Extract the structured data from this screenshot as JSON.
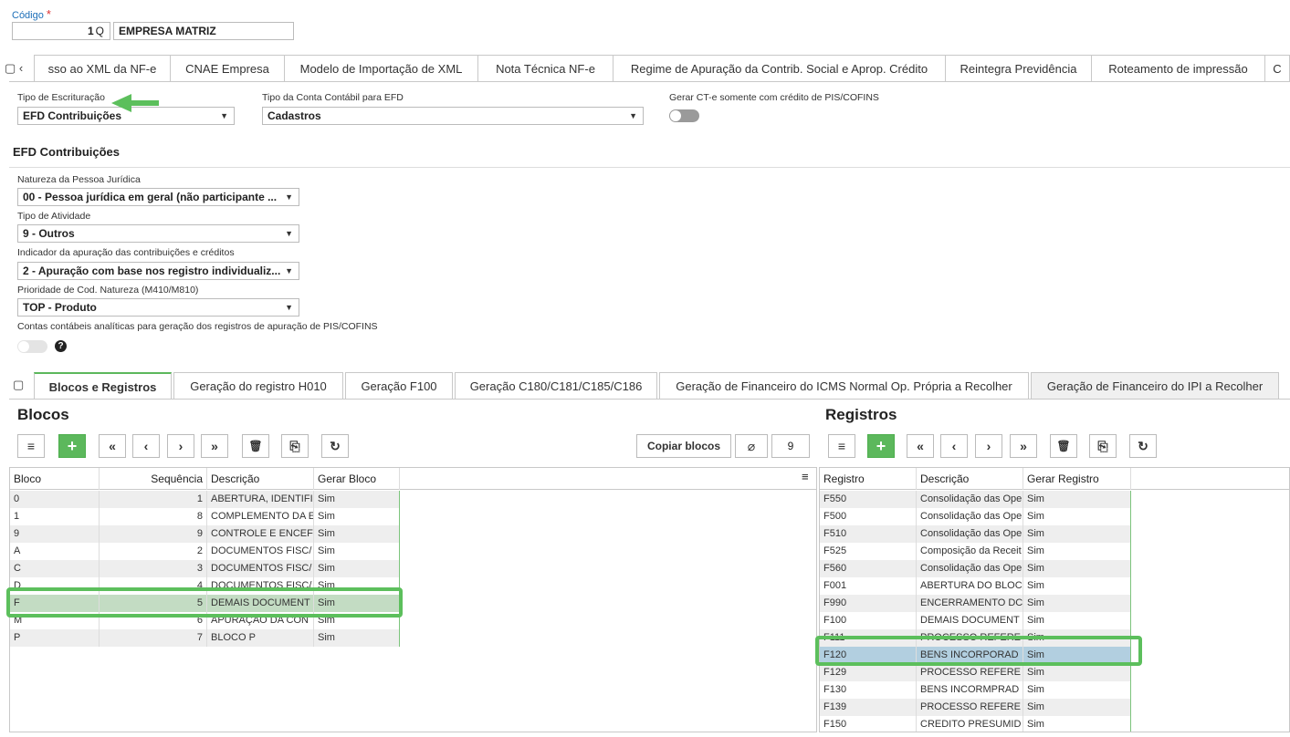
{
  "header": {
    "code_label": "Código",
    "required_mark": "*",
    "code_value": "1",
    "search_glyph": "Q",
    "company": "EMPRESA MATRIZ"
  },
  "top_tabs": [
    "sso ao XML da NF-e",
    "CNAE Empresa",
    "Modelo de Importação de XML",
    "Nota Técnica NF-e",
    "Regime de Apuração da Contrib. Social e Aprop. Crédito",
    "Reintegra Previdência",
    "Roteamento de impressão",
    "C"
  ],
  "form": {
    "tipo_escrituracao_label": "Tipo de Escrituração",
    "tipo_escrituracao_value": "EFD Contribuições",
    "tipo_conta_label": "Tipo da Conta Contábil para EFD",
    "tipo_conta_value": "Cadastros",
    "gerar_cte_label": "Gerar CT-e somente com crédito de PIS/COFINS",
    "section_title": "EFD Contribuições",
    "natureza_label": "Natureza da Pessoa Jurídica",
    "natureza_value": "00 - Pessoa jurídica em geral (não participante ...",
    "atividade_label": "Tipo de Atividade",
    "atividade_value": "9 - Outros",
    "indicador_label": "Indicador da apuração das contribuições e créditos",
    "indicador_value": "2 - Apuração com base nos registro individualiz...",
    "prioridade_label": "Prioridade de Cod. Natureza (M410/M810)",
    "prioridade_value": "TOP - Produto",
    "contas_label": "Contas contábeis analíticas para geração dos registros de apuração de PIS/COFINS",
    "help_glyph": "?",
    "caret": "▼"
  },
  "bottom_tabs": [
    "Blocos e Registros",
    "Geração do registro H010",
    "Geração F100",
    "Geração C180/C181/C185/C186",
    "Geração de Financeiro do ICMS Normal Op. Própria a Recolher",
    "Geração de Financeiro do IPI a Recolher"
  ],
  "blocos": {
    "title": "Blocos",
    "copy_button": "Copiar blocos",
    "count": "9",
    "columns": [
      "Bloco",
      "Sequência",
      "Descrição",
      "Gerar Bloco"
    ],
    "rows": [
      [
        "0",
        "1",
        "ABERTURA, IDENTIFI",
        "Sim"
      ],
      [
        "1",
        "8",
        "COMPLEMENTO DA E",
        "Sim"
      ],
      [
        "9",
        "9",
        "CONTROLE E ENCEF",
        "Sim"
      ],
      [
        "A",
        "2",
        "DOCUMENTOS FISC/",
        "Sim"
      ],
      [
        "C",
        "3",
        "DOCUMENTOS FISC/",
        "Sim"
      ],
      [
        "D",
        "4",
        "DOCUMENTOS FISC/",
        "Sim"
      ],
      [
        "F",
        "5",
        "DEMAIS DOCUMENT",
        "Sim"
      ],
      [
        "M",
        "6",
        "APURAÇÃO DA CON",
        "Sim"
      ],
      [
        "P",
        "7",
        "BLOCO P",
        "Sim"
      ]
    ]
  },
  "registros": {
    "title": "Registros",
    "columns": [
      "Registro",
      "Descrição",
      "Gerar Registro"
    ],
    "rows": [
      [
        "F550",
        "Consolidação das Ope",
        "Sim"
      ],
      [
        "F500",
        "Consolidação das Ope",
        "Sim"
      ],
      [
        "F510",
        "Consolidação das Ope",
        "Sim"
      ],
      [
        "F525",
        "Composição da Receit",
        "Sim"
      ],
      [
        "F560",
        "Consolidação das Ope",
        "Sim"
      ],
      [
        "F001",
        "ABERTURA DO BLOC",
        "Sim"
      ],
      [
        "F990",
        "ENCERRAMENTO DC",
        "Sim"
      ],
      [
        "F100",
        "DEMAIS DOCUMENT",
        "Sim"
      ],
      [
        "F111",
        "PROCESSO REFERE",
        "Sim"
      ],
      [
        "F120",
        "BENS INCORPORAD",
        "Sim"
      ],
      [
        "F129",
        "PROCESSO REFERE",
        "Sim"
      ],
      [
        "F130",
        "BENS INCORMPRAD",
        "Sim"
      ],
      [
        "F139",
        "PROCESSO REFERE",
        "Sim"
      ],
      [
        "F150",
        "CREDITO PRESUMID",
        "Sim"
      ]
    ]
  },
  "toolbar": {
    "list": "≡",
    "add": "+",
    "first": "«",
    "prev": "‹",
    "next": "›",
    "last": "»",
    "delete": "🗑",
    "copy": "⎘",
    "refresh": "↻",
    "clip": "⌀"
  },
  "colors": {
    "accent_green": "#5cb85c",
    "link_blue": "#1d6fb8",
    "highlight": "#5cbf5c"
  }
}
